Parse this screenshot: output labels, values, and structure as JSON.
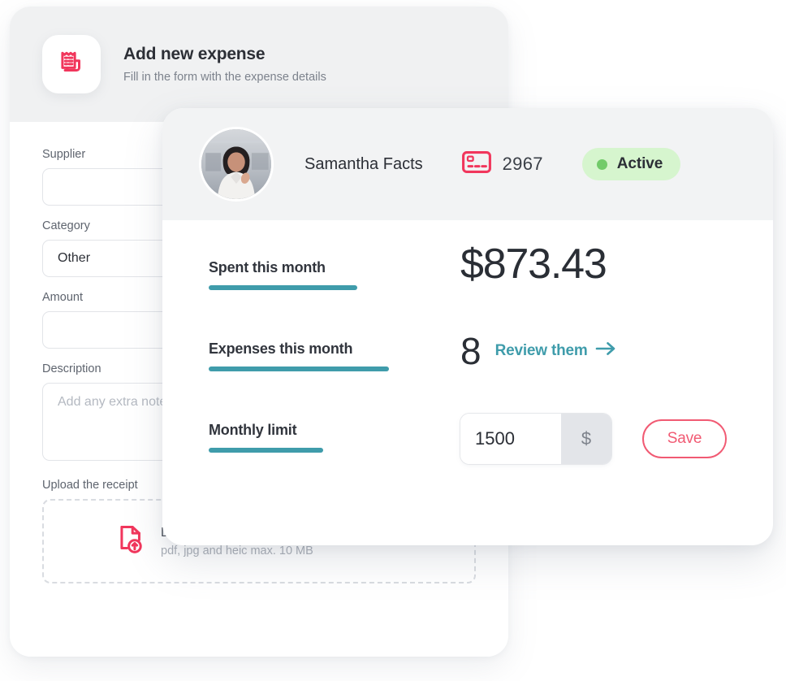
{
  "colors": {
    "accent_red": "#f1365c",
    "accent_teal": "#3f9cab",
    "save_border": "#f15a73",
    "status_bg": "#d6f5ce",
    "status_dot": "#72cb6a",
    "header_gray": "#f1f2f3",
    "text_dark": "#2c2f36",
    "text_muted": "#7c828c"
  },
  "expense_form": {
    "icon": "receipt-icon",
    "title": "Add new expense",
    "subtitle": "Fill in the form with the expense details",
    "fields": [
      {
        "label": "Supplier",
        "value": "",
        "placeholder": "",
        "type": "text"
      },
      {
        "label": "Category",
        "value": "Other",
        "placeholder": "",
        "type": "select"
      },
      {
        "label": "Amount",
        "value": "",
        "placeholder": "",
        "type": "text"
      },
      {
        "label": "Description",
        "value": "",
        "placeholder": "Add any extra notes",
        "type": "textarea"
      }
    ],
    "upload": {
      "label": "Upload the receipt",
      "icon": "file-upload-icon",
      "main_text": "Drag and drop here or click to browse",
      "hint_text": "pdf, jpg and heic max. 10 MB"
    }
  },
  "card_panel": {
    "header": {
      "avatar": "user-avatar",
      "user_name": "Samantha Facts",
      "card_icon": "credit-card-icon",
      "card_number": "2967",
      "status": {
        "label": "Active",
        "dot": "status-dot-icon"
      }
    },
    "stats": [
      {
        "label": "Spent this month",
        "value": "$873.43"
      },
      {
        "label": "Expenses this month",
        "value": "8",
        "link_label": "Review them",
        "link_icon": "arrow-right-icon"
      }
    ],
    "monthly_limit": {
      "label": "Monthly limit",
      "value": "1500",
      "placeholder": "1500",
      "currency_suffix": "$",
      "save_label": "Save"
    }
  }
}
